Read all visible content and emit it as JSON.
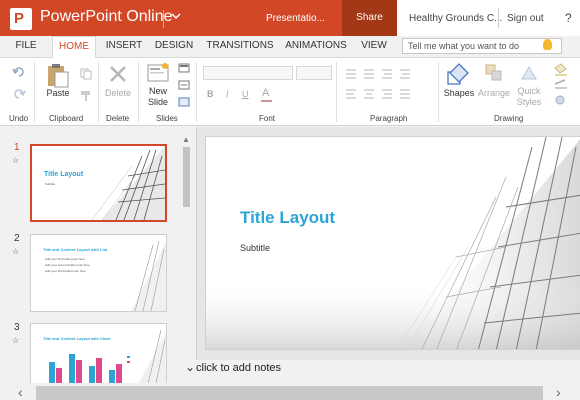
{
  "titlebar": {
    "app_letter": "P",
    "app_title": "PowerPoint Online",
    "doc_title": "Presentatio...",
    "share_label": "Share",
    "account_name": "Healthy Grounds C...",
    "signout_label": "Sign out",
    "help_label": "?"
  },
  "tabs": [
    "FILE",
    "HOME",
    "INSERT",
    "DESIGN",
    "TRANSITIONS",
    "ANIMATIONS",
    "VIEW"
  ],
  "active_tab": "HOME",
  "tellme": {
    "placeholder": "Tell me what you want to do"
  },
  "ribbon": {
    "paste_label": "Paste",
    "delete_label": "Delete",
    "new_slide_label": "New\nSlide",
    "shapes_label": "Shapes",
    "arrange_label": "Arrange",
    "quick_styles_label": "Quick\nStyles",
    "groups": [
      "Undo",
      "Clipboard",
      "Delete",
      "Slides",
      "Font",
      "Paragraph",
      "Drawing"
    ]
  },
  "slides": [
    {
      "number": "1",
      "title": "Title Layout",
      "subtitle": "Subtitle"
    },
    {
      "number": "2",
      "title": "Title and Content Layout with List",
      "bullets": [
        "Add your first bullet point here",
        "Add your second bullet point here",
        "Add your third bullet point here"
      ]
    },
    {
      "number": "3",
      "title": "Title and Content Layout with Chart"
    }
  ],
  "main_slide": {
    "title": "Title Layout",
    "subtitle": "Subtitle"
  },
  "notes": {
    "placeholder": "click to add notes"
  },
  "colors": {
    "accent": "#d24726",
    "share_bg": "#a33716",
    "title_blue": "#2ba5d6"
  }
}
